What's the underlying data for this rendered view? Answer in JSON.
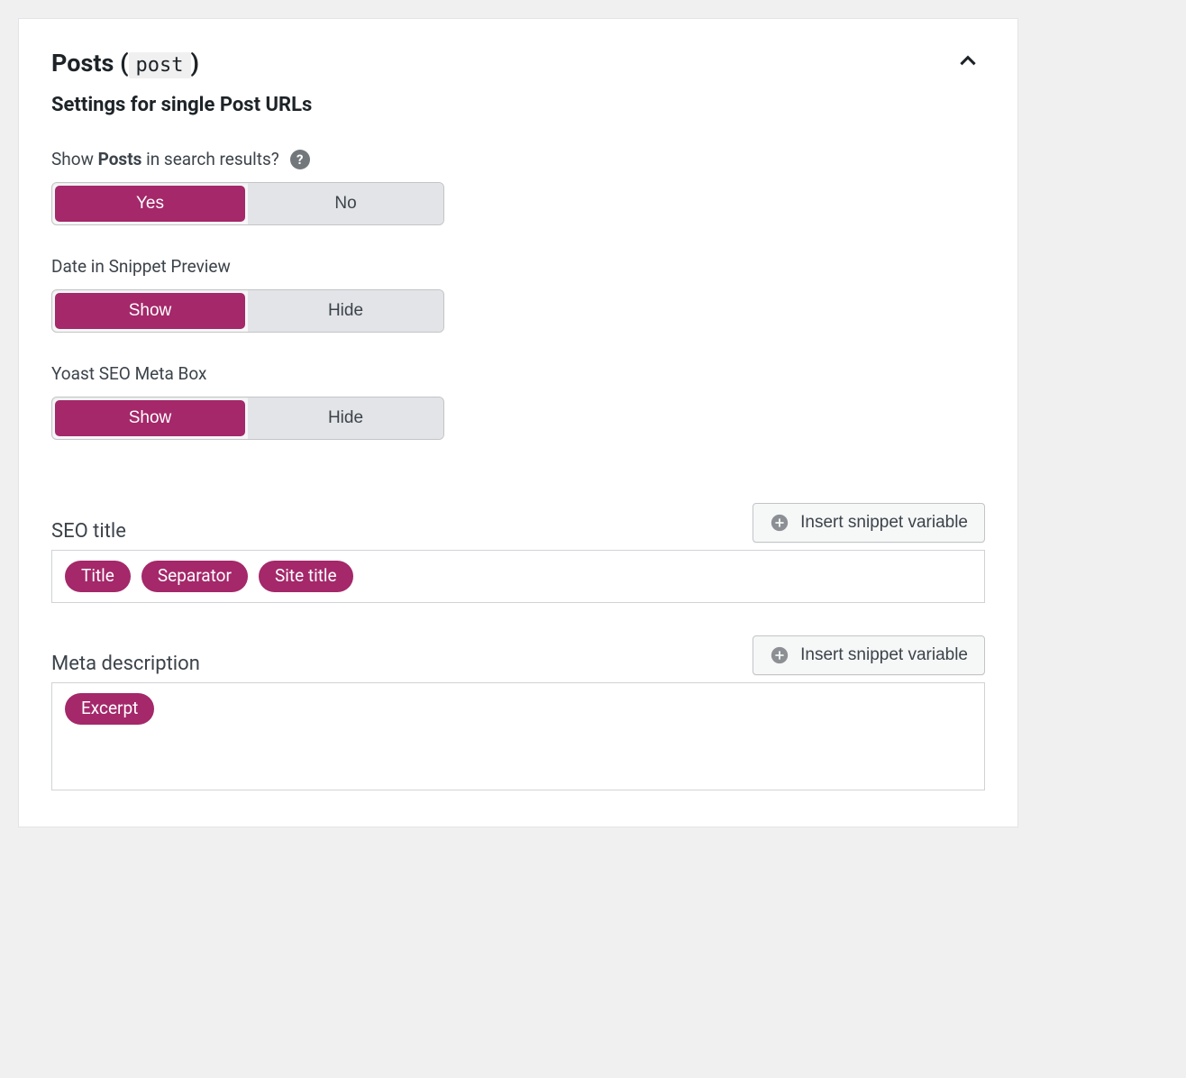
{
  "panel": {
    "title_prefix": "Posts",
    "title_code": "post",
    "subheading": "Settings for single Post URLs"
  },
  "fields": {
    "show_in_search": {
      "label_prefix": "Show ",
      "label_bold": "Posts",
      "label_suffix": " in search results?",
      "options": {
        "yes": "Yes",
        "no": "No"
      }
    },
    "date_snippet": {
      "label": "Date in Snippet Preview",
      "options": {
        "show": "Show",
        "hide": "Hide"
      }
    },
    "meta_box": {
      "label": "Yoast SEO Meta Box",
      "options": {
        "show": "Show",
        "hide": "Hide"
      }
    }
  },
  "seo_title": {
    "label": "SEO title",
    "insert_button": "Insert snippet variable",
    "chips": [
      "Title",
      "Separator",
      "Site title"
    ]
  },
  "meta_desc": {
    "label": "Meta description",
    "insert_button": "Insert snippet variable",
    "chips": [
      "Excerpt"
    ]
  }
}
